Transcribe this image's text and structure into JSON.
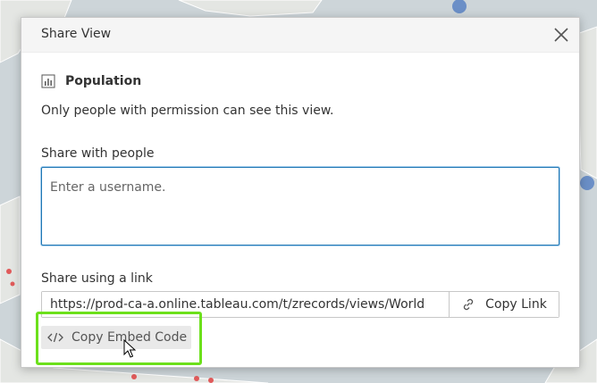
{
  "dialog": {
    "title": "Share View",
    "view_name": "Population",
    "view_icon": "bar-chart-icon",
    "permission_note": "Only people with permission can see this view.",
    "share_people_label": "Share with people",
    "username_placeholder": "Enter a username.",
    "share_link_label": "Share using a link",
    "link_url": "https://prod-ca-a.online.tableau.com/t/zrecords/views/World",
    "copy_link_label": "Copy Link",
    "copy_embed_label": "Copy Embed Code"
  },
  "colors": {
    "input_focus_border": "#1f77b4",
    "highlight": "#6ce01b",
    "map_dot_blue": "#6b8fc7",
    "map_dot_red": "#e05a5a"
  },
  "icons": [
    "close-icon",
    "bar-chart-icon",
    "link-icon",
    "code-icon",
    "cursor-icon"
  ]
}
